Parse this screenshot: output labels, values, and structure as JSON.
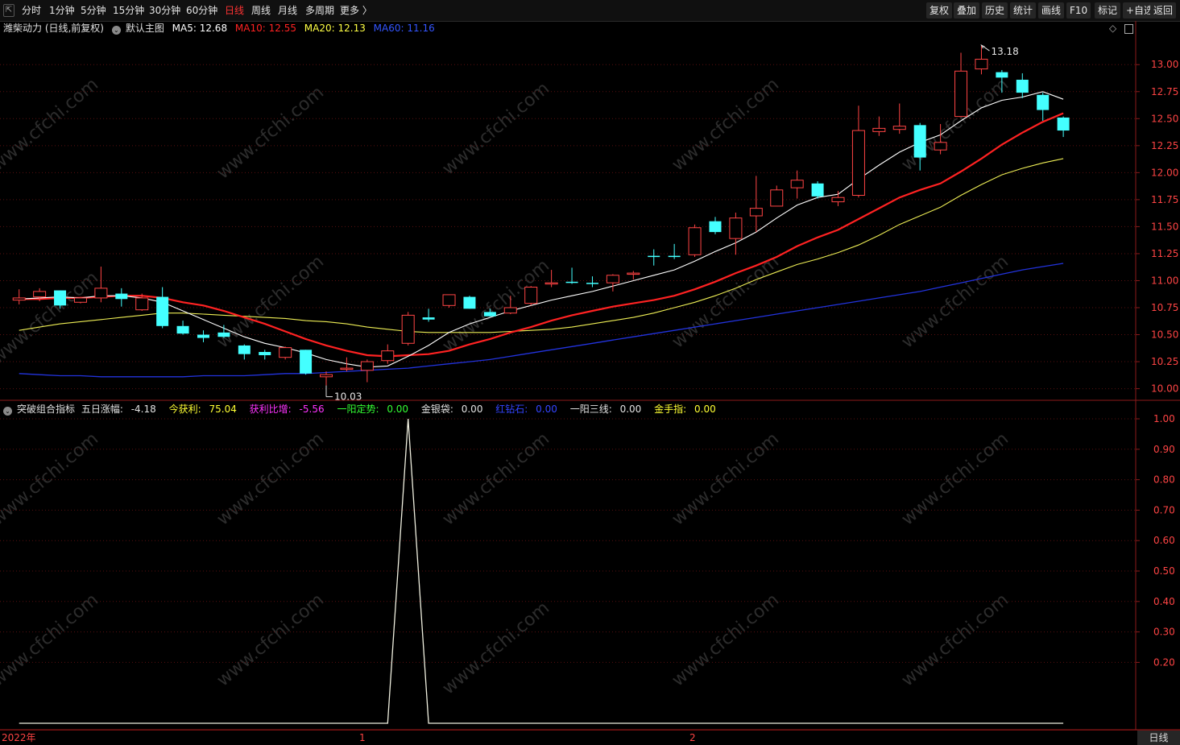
{
  "toolbar": {
    "periods": [
      "分时",
      "1分钟",
      "5分钟",
      "15分钟",
      "30分钟",
      "60分钟",
      "日线",
      "周线",
      "月线",
      "多周期",
      "更多 〉"
    ],
    "active_period": "日线",
    "right_buttons": [
      "复权",
      "叠加",
      "历史",
      "统计",
      "画线",
      "F10",
      "标记",
      "+自选",
      "返回"
    ]
  },
  "main_chart": {
    "stock_label": "潍柴动力 (日线,前复权)",
    "template_label": "默认主图",
    "ma": [
      {
        "label": "MA5: 12.68",
        "color": "#ffffff"
      },
      {
        "label": "MA10: 12.55",
        "color": "#ff2222"
      },
      {
        "label": "MA20: 12.13",
        "color": "#ffff44"
      },
      {
        "label": "MA60: 11.16",
        "color": "#3355ff"
      }
    ],
    "high_marker": "13.18",
    "low_marker": "10.03",
    "y_ticks": [
      "13.00",
      "12.75",
      "12.50",
      "12.25",
      "12.00",
      "11.75",
      "11.50",
      "11.25",
      "11.00",
      "10.75",
      "10.50",
      "10.25",
      "10.00"
    ]
  },
  "indicator_panel": {
    "name": "突破组合指标",
    "values": [
      {
        "label": "五日涨幅:",
        "value": "-4.18",
        "color": "#e0e0e0"
      },
      {
        "label": "今获利:",
        "value": "75.04",
        "color": "#ffff33"
      },
      {
        "label": "获利比增:",
        "value": "-5.56",
        "color": "#ff33ff"
      },
      {
        "label": "一阳定势:",
        "value": "0.00",
        "color": "#33ff33"
      },
      {
        "label": "金银袋:",
        "value": "0.00",
        "color": "#e0e0e0"
      },
      {
        "label": "红钻石:",
        "value": "0.00",
        "color": "#3344ff"
      },
      {
        "label": "一阳三线:",
        "value": "0.00",
        "color": "#e0e0e0"
      },
      {
        "label": "金手指:",
        "value": "0.00",
        "color": "#ffff33"
      }
    ],
    "y_ticks": [
      "1.00",
      "0.90",
      "0.80",
      "0.70",
      "0.60",
      "0.50",
      "0.40",
      "0.30",
      "0.20"
    ]
  },
  "time_axis": {
    "labels": [
      "2022年",
      "1",
      "2"
    ],
    "period_label": "日线"
  },
  "watermark": "www.cfchi.com",
  "colors": {
    "up": "#ff4444",
    "down": "#44ffff",
    "axis": "#8b1a1a",
    "price_tick": "#ff4444"
  },
  "chart_data": {
    "type": "candlestick",
    "candles": [
      {
        "o": 10.82,
        "h": 10.92,
        "l": 10.78,
        "c": 10.84
      },
      {
        "o": 10.85,
        "h": 10.93,
        "l": 10.81,
        "c": 10.9
      },
      {
        "o": 10.91,
        "h": 10.91,
        "l": 10.74,
        "c": 10.77
      },
      {
        "o": 10.8,
        "h": 10.85,
        "l": 10.79,
        "c": 10.84
      },
      {
        "o": 10.84,
        "h": 11.13,
        "l": 10.8,
        "c": 10.93
      },
      {
        "o": 10.88,
        "h": 10.93,
        "l": 10.76,
        "c": 10.83
      },
      {
        "o": 10.73,
        "h": 10.88,
        "l": 10.72,
        "c": 10.84
      },
      {
        "o": 10.85,
        "h": 10.94,
        "l": 10.56,
        "c": 10.58
      },
      {
        "o": 10.58,
        "h": 10.63,
        "l": 10.5,
        "c": 10.51
      },
      {
        "o": 10.5,
        "h": 10.54,
        "l": 10.43,
        "c": 10.47
      },
      {
        "o": 10.52,
        "h": 10.59,
        "l": 10.47,
        "c": 10.48
      },
      {
        "o": 10.4,
        "h": 10.41,
        "l": 10.27,
        "c": 10.32
      },
      {
        "o": 10.34,
        "h": 10.36,
        "l": 10.27,
        "c": 10.31
      },
      {
        "o": 10.29,
        "h": 10.39,
        "l": 10.27,
        "c": 10.38
      },
      {
        "o": 10.36,
        "h": 10.36,
        "l": 10.13,
        "c": 10.14
      },
      {
        "o": 10.11,
        "h": 10.16,
        "l": 10.03,
        "c": 10.13
      },
      {
        "o": 10.18,
        "h": 10.29,
        "l": 10.16,
        "c": 10.19
      },
      {
        "o": 10.17,
        "h": 10.27,
        "l": 10.06,
        "c": 10.25
      },
      {
        "o": 10.26,
        "h": 10.41,
        "l": 10.23,
        "c": 10.35
      },
      {
        "o": 10.42,
        "h": 10.71,
        "l": 10.4,
        "c": 10.68
      },
      {
        "o": 10.66,
        "h": 10.74,
        "l": 10.62,
        "c": 10.64
      },
      {
        "o": 10.77,
        "h": 10.87,
        "l": 10.75,
        "c": 10.87
      },
      {
        "o": 10.85,
        "h": 10.86,
        "l": 10.74,
        "c": 10.74
      },
      {
        "o": 10.71,
        "h": 10.74,
        "l": 10.67,
        "c": 10.67
      },
      {
        "o": 10.7,
        "h": 10.86,
        "l": 10.69,
        "c": 10.75
      },
      {
        "o": 10.79,
        "h": 10.95,
        "l": 10.77,
        "c": 10.94
      },
      {
        "o": 10.98,
        "h": 11.1,
        "l": 10.94,
        "c": 10.98
      },
      {
        "o": 10.99,
        "h": 11.12,
        "l": 10.97,
        "c": 10.98
      },
      {
        "o": 10.98,
        "h": 11.04,
        "l": 10.94,
        "c": 10.97
      },
      {
        "o": 10.98,
        "h": 11.06,
        "l": 10.9,
        "c": 11.05
      },
      {
        "o": 11.07,
        "h": 11.09,
        "l": 11.01,
        "c": 11.07
      },
      {
        "o": 11.23,
        "h": 11.29,
        "l": 11.14,
        "c": 11.22
      },
      {
        "o": 11.23,
        "h": 11.34,
        "l": 11.2,
        "c": 11.22
      },
      {
        "o": 11.24,
        "h": 11.52,
        "l": 11.22,
        "c": 11.49
      },
      {
        "o": 11.55,
        "h": 11.59,
        "l": 11.43,
        "c": 11.45
      },
      {
        "o": 11.39,
        "h": 11.63,
        "l": 11.24,
        "c": 11.58
      },
      {
        "o": 11.6,
        "h": 11.97,
        "l": 11.45,
        "c": 11.67
      },
      {
        "o": 11.69,
        "h": 11.88,
        "l": 11.69,
        "c": 11.84
      },
      {
        "o": 11.86,
        "h": 12.02,
        "l": 11.76,
        "c": 11.93
      },
      {
        "o": 11.9,
        "h": 11.92,
        "l": 11.76,
        "c": 11.78
      },
      {
        "o": 11.73,
        "h": 11.83,
        "l": 11.69,
        "c": 11.77
      },
      {
        "o": 11.79,
        "h": 12.62,
        "l": 11.77,
        "c": 12.39
      },
      {
        "o": 12.38,
        "h": 12.52,
        "l": 12.34,
        "c": 12.41
      },
      {
        "o": 12.4,
        "h": 12.64,
        "l": 12.36,
        "c": 12.43
      },
      {
        "o": 12.44,
        "h": 12.46,
        "l": 12.02,
        "c": 12.14
      },
      {
        "o": 12.21,
        "h": 12.45,
        "l": 12.17,
        "c": 12.28
      },
      {
        "o": 12.52,
        "h": 13.11,
        "l": 12.52,
        "c": 12.94
      },
      {
        "o": 12.96,
        "h": 13.18,
        "l": 12.91,
        "c": 13.05
      },
      {
        "o": 12.93,
        "h": 12.95,
        "l": 12.74,
        "c": 12.88
      },
      {
        "o": 12.86,
        "h": 12.92,
        "l": 12.69,
        "c": 12.74
      },
      {
        "o": 12.72,
        "h": 12.74,
        "l": 12.48,
        "c": 12.58
      },
      {
        "o": 12.51,
        "h": 12.52,
        "l": 12.33,
        "c": 12.39
      }
    ],
    "ma5": [
      10.83,
      10.84,
      10.85,
      10.84,
      10.86,
      10.86,
      10.84,
      10.8,
      10.72,
      10.64,
      10.56,
      10.48,
      10.42,
      10.38,
      10.33,
      10.27,
      10.23,
      10.2,
      10.21,
      10.3,
      10.4,
      10.52,
      10.6,
      10.66,
      10.72,
      10.77,
      10.82,
      10.86,
      10.9,
      10.95,
      11.0,
      11.05,
      11.1,
      11.18,
      11.27,
      11.35,
      11.45,
      11.58,
      11.7,
      11.77,
      11.8,
      11.94,
      12.07,
      12.19,
      12.28,
      12.35,
      12.48,
      12.6,
      12.67,
      12.7,
      12.75,
      12.68
    ],
    "ma10": [
      10.83,
      10.83,
      10.84,
      10.84,
      10.85,
      10.86,
      10.86,
      10.84,
      10.8,
      10.77,
      10.72,
      10.66,
      10.6,
      10.53,
      10.46,
      10.4,
      10.35,
      10.31,
      10.3,
      10.31,
      10.32,
      10.35,
      10.41,
      10.46,
      10.52,
      10.57,
      10.63,
      10.68,
      10.72,
      10.76,
      10.79,
      10.82,
      10.86,
      10.92,
      10.99,
      11.07,
      11.14,
      11.22,
      11.32,
      11.4,
      11.47,
      11.57,
      11.67,
      11.77,
      11.84,
      11.9,
      12.01,
      12.13,
      12.26,
      12.37,
      12.47,
      12.55
    ],
    "ma20": [
      10.54,
      10.57,
      10.6,
      10.62,
      10.64,
      10.66,
      10.68,
      10.7,
      10.7,
      10.69,
      10.68,
      10.67,
      10.66,
      10.65,
      10.63,
      10.62,
      10.6,
      10.57,
      10.55,
      10.53,
      10.52,
      10.52,
      10.52,
      10.52,
      10.53,
      10.54,
      10.55,
      10.57,
      10.6,
      10.63,
      10.66,
      10.7,
      10.75,
      10.8,
      10.86,
      10.93,
      11.01,
      11.08,
      11.15,
      11.2,
      11.26,
      11.33,
      11.42,
      11.52,
      11.6,
      11.68,
      11.79,
      11.89,
      11.98,
      12.04,
      12.09,
      12.13
    ],
    "ma60": [
      10.14,
      10.13,
      10.12,
      10.12,
      10.11,
      10.11,
      10.11,
      10.11,
      10.11,
      10.12,
      10.12,
      10.12,
      10.13,
      10.14,
      10.14,
      10.15,
      10.16,
      10.17,
      10.18,
      10.19,
      10.21,
      10.23,
      10.25,
      10.27,
      10.3,
      10.33,
      10.36,
      10.39,
      10.42,
      10.45,
      10.48,
      10.51,
      10.54,
      10.57,
      10.6,
      10.63,
      10.66,
      10.69,
      10.72,
      10.75,
      10.78,
      10.81,
      10.84,
      10.87,
      10.9,
      10.94,
      10.98,
      11.02,
      11.06,
      11.1,
      11.13,
      11.16
    ],
    "indicator": [
      0,
      0,
      0,
      0,
      0,
      0,
      0,
      0,
      0,
      0,
      0,
      0,
      0,
      0,
      0,
      0,
      0,
      0,
      0,
      1,
      0,
      0,
      0,
      0,
      0,
      0,
      0,
      0,
      0,
      0,
      0,
      0,
      0,
      0,
      0,
      0,
      0,
      0,
      0,
      0,
      0,
      0,
      0,
      0,
      0,
      0,
      0,
      0,
      0,
      0,
      0,
      0
    ],
    "ylim": [
      9.9,
      13.3
    ],
    "indicator_ylim": [
      0,
      1.0
    ]
  }
}
